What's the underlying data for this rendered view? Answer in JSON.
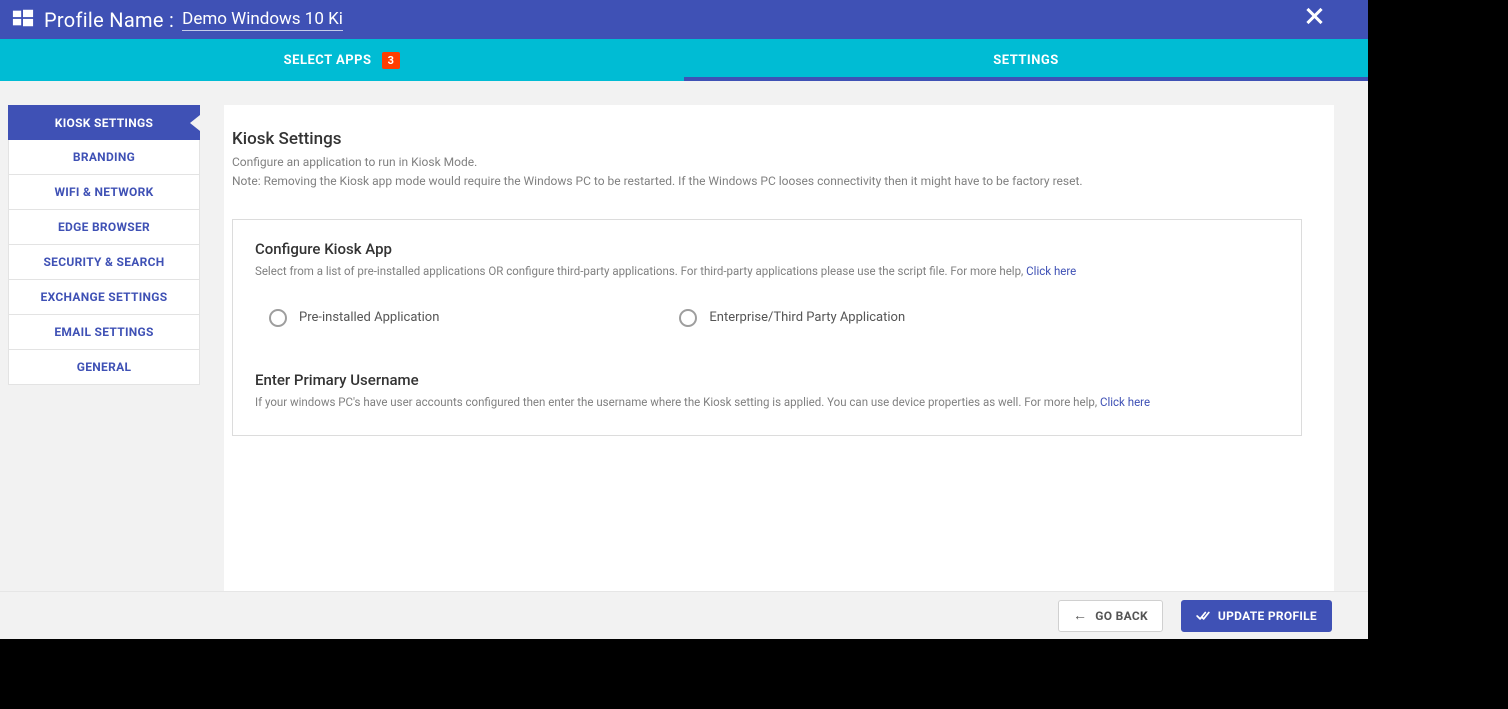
{
  "header": {
    "profile_label": "Profile Name :",
    "profile_name": "Demo Windows 10 Ki"
  },
  "tabs": {
    "select_apps_label": "SELECT APPS",
    "select_apps_badge": "3",
    "settings_label": "SETTINGS"
  },
  "sidebar": {
    "items": [
      {
        "label": "KIOSK SETTINGS",
        "active": true
      },
      {
        "label": "BRANDING",
        "active": false
      },
      {
        "label": "WIFI & NETWORK",
        "active": false
      },
      {
        "label": "EDGE BROWSER",
        "active": false
      },
      {
        "label": "SECURITY & SEARCH",
        "active": false
      },
      {
        "label": "EXCHANGE SETTINGS",
        "active": false
      },
      {
        "label": "EMAIL SETTINGS",
        "active": false
      },
      {
        "label": "GENERAL",
        "active": false
      }
    ]
  },
  "main": {
    "title": "Kiosk Settings",
    "subtitle": "Configure an application to run in Kiosk Mode.",
    "note": "Note: Removing the Kiosk app mode would require the Windows PC to be restarted. If the Windows PC looses connectivity then it might have to be factory reset.",
    "configure": {
      "title": "Configure Kiosk App",
      "help_prefix": "Select from a list of pre-installed applications OR configure third-party applications. For third-party applications please use the script file. For more help, ",
      "click_here": "Click here",
      "radio1": "Pre-installed Application",
      "radio2": "Enterprise/Third Party Application"
    },
    "username": {
      "title": "Enter Primary Username",
      "help_prefix": "If your windows PC's have user accounts configured then enter the username where the Kiosk setting is applied. You can use device properties as well. For more help, ",
      "click_here": "Click here"
    }
  },
  "footer": {
    "go_back": "GO BACK",
    "update_profile": "UPDATE PROFILE"
  }
}
